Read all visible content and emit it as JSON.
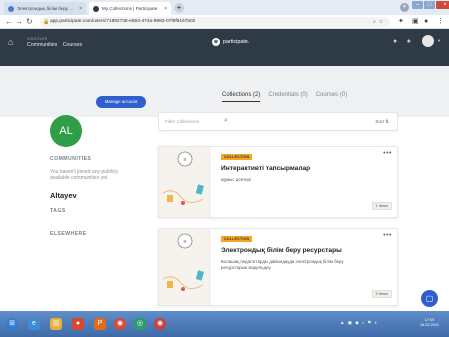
{
  "browser": {
    "tabs": [
      {
        "title": "Электрондық білім беру ресурс"
      },
      {
        "title": "My Collections | Participate"
      }
    ],
    "url": "app.participate.com/users/71882735-e694-474a-9983-07f9f9167b02"
  },
  "app": {
    "nav_small": "DISCOVER",
    "nav_items": [
      "Communities",
      "Courses"
    ],
    "brand": "participate."
  },
  "profile": {
    "initials": "AL",
    "manage_label": "Manage account",
    "name": "Altayev"
  },
  "sidebar": {
    "communities_heading": "COMMUNITIES",
    "communities_text": "You haven't joined any publicly available communities yet.",
    "tags_heading": "TAGS",
    "elsewhere_heading": "ELSEWHERE"
  },
  "tabs": [
    {
      "label": "Collections (2)",
      "active": true
    },
    {
      "label": "Credentials (0)",
      "active": false
    },
    {
      "label": "Courses (0)",
      "active": false
    }
  ],
  "filter": {
    "placeholder": "Filter Collections",
    "sort_label": "Sort"
  },
  "collections": [
    {
      "badge": "COLLECTION",
      "title": "Интерактивті тапсырмалар",
      "description": "жұмыс дәптері",
      "count": "1 Items"
    },
    {
      "badge": "COLLECTION",
      "title": "Электрондық білім беру ресурстары",
      "description": "Болашақ педагогтарды дайындауда электрондық білім беру ресурстарын модельдеу",
      "count": "3 Items"
    }
  ],
  "taskbar": {
    "clock_time": "17:09",
    "clock_date": "16.02.2021"
  },
  "colors": {
    "header": "#2e3a46",
    "accent": "#2f5fcc",
    "avatar": "#2f9e47",
    "badge": "#f5a623"
  }
}
